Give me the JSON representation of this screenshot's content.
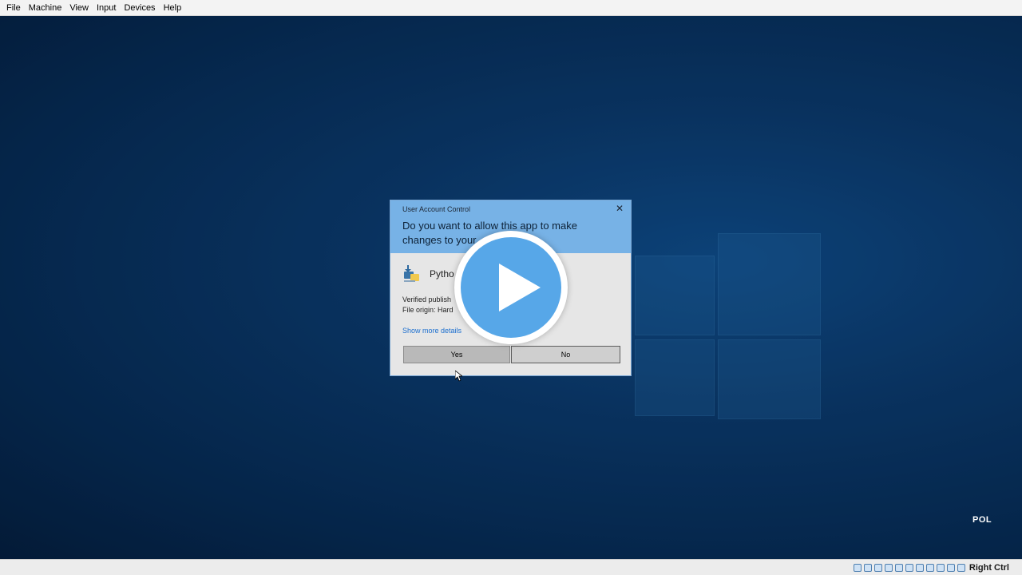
{
  "menubar": {
    "items": [
      "File",
      "Machine",
      "View",
      "Input",
      "Devices",
      "Help"
    ]
  },
  "desktop": {
    "language_indicator": "POL"
  },
  "uac": {
    "title": "User Account Control",
    "close_glyph": "✕",
    "question": "Do you want to allow this app to make changes to your",
    "app_name": "Pytho",
    "publisher_line": "Verified publish",
    "origin_line": "File origin: Hard",
    "details_link": "Show more details",
    "yes_label": "Yes",
    "no_label": "No"
  },
  "statusbar": {
    "icons": [
      "hard-disk-icon",
      "optical-drive-icon",
      "audio-icon",
      "network-icon",
      "usb-icon",
      "shared-folder-icon",
      "display-icon",
      "video-capture-icon",
      "virtualization-icon",
      "mouse-integration-icon",
      "keyboard-icon"
    ],
    "host_key": "Right Ctrl"
  },
  "colors": {
    "uac_header": "#77b2e6",
    "play_button": "#57a7e8",
    "link": "#1c6fcf"
  }
}
